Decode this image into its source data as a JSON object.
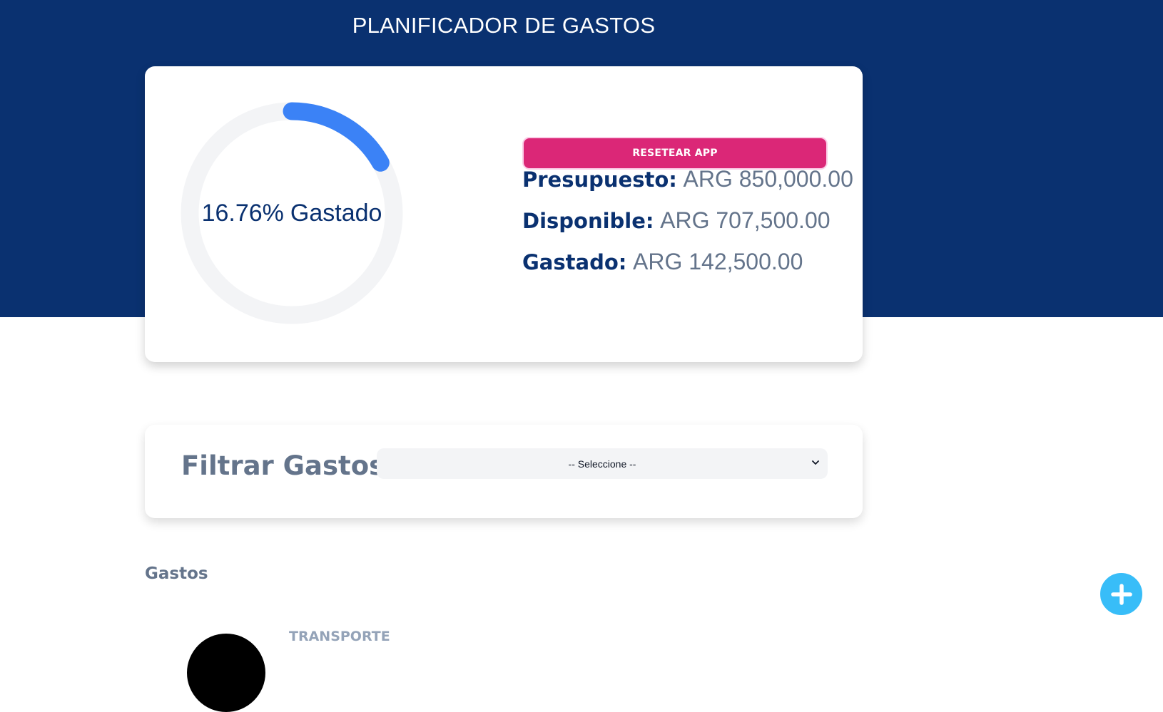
{
  "app": {
    "title": "PLANIFICADOR DE GASTOS"
  },
  "budget_card": {
    "progress": {
      "percentage": 16.76,
      "percentage_text": "16.76%",
      "suffix": "Gastado",
      "track_color": "#f3f4f6",
      "bar_color": "#3b82f6"
    },
    "reset_button_label": "RESETEAR APP",
    "stats": [
      {
        "label": "Presupuesto:",
        "value": "ARG 850,000.00"
      },
      {
        "label": "Disponible:",
        "value": "ARG 707,500.00"
      },
      {
        "label": "Gastado:",
        "value": "ARG 142,500.00"
      }
    ]
  },
  "filter": {
    "label": "Filtrar Gastos",
    "selected_option": "-- Seleccione --"
  },
  "expenses": {
    "heading": "Gastos",
    "items": [
      {
        "category": "TRANSPORTE",
        "icon": "transport-icon"
      }
    ]
  },
  "fab": {
    "icon": "plus-icon",
    "color": "#38bdf8"
  },
  "colors": {
    "header_bg": "#0a3170",
    "accent_pink": "#db2777",
    "text_slate": "#64748b"
  }
}
